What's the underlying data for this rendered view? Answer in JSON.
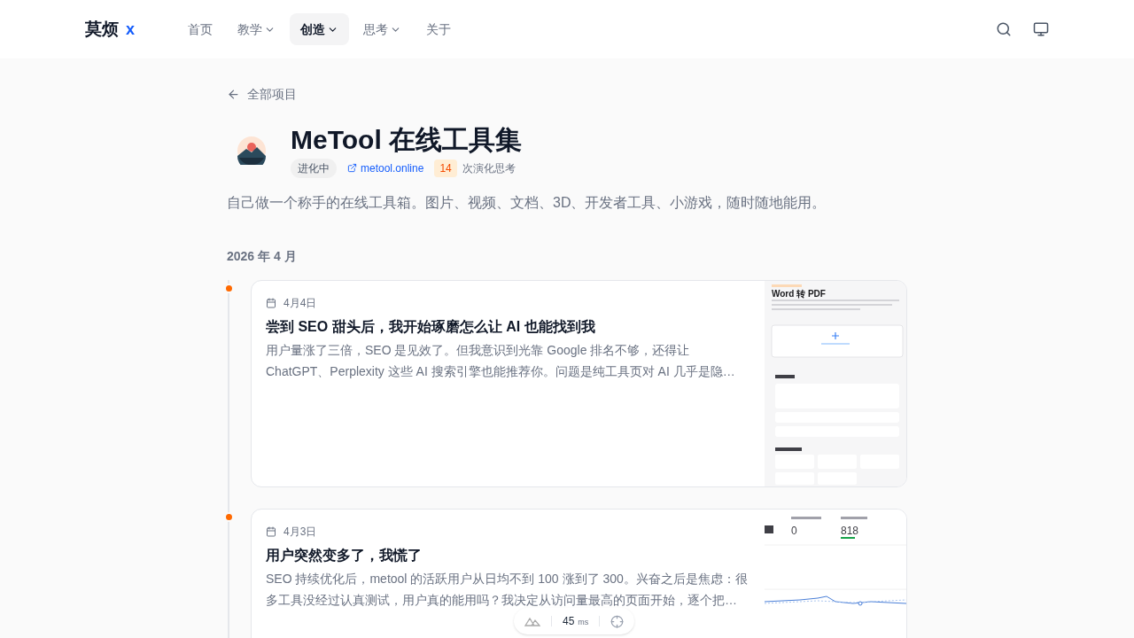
{
  "nav": {
    "logo": "莫烦",
    "logo_mark": "x",
    "items": [
      {
        "label": "首页",
        "dropdown": false,
        "selected": false
      },
      {
        "label": "教学",
        "dropdown": true,
        "selected": false
      },
      {
        "label": "创造",
        "dropdown": true,
        "selected": true
      },
      {
        "label": "思考",
        "dropdown": true,
        "selected": false
      },
      {
        "label": "关于",
        "dropdown": false,
        "selected": false
      }
    ]
  },
  "back_link": "全部项目",
  "project": {
    "title": "MeTool 在线工具集",
    "status": "进化中",
    "link": "metool.online",
    "count": "14",
    "count_label": "次演化思考",
    "description": "自己做一个称手的在线工具箱。图片、视频、文档、3D、开发者工具、小游戏，随时随地能用。"
  },
  "month": "2026 年 4 月",
  "posts": [
    {
      "date": "4月4日",
      "title": "尝到 SEO 甜头后，我开始琢磨怎么让 AI 也能找到我",
      "excerpt": "用户量涨了三倍，SEO 是见效了。但我意识到光靠 Google 排名不够，还得让 ChatGPT、Perplexity 这些 AI 搜索引擎也能推荐你。问题是纯工具页对 AI 几乎是隐…",
      "thumbnail": {
        "kind": "tool_page",
        "title": "Word 转 PDF"
      }
    },
    {
      "date": "4月3日",
      "title": "用户突然变多了，我慌了",
      "excerpt": "SEO 持续优化后，metool 的活跃用户从日均不到 100 涨到了 300。兴奋之后是焦虑：很多工具没经过认真测试，用户真的能用吗？我决定从访问量最高的页面开始，逐个把…",
      "thumbnail": {
        "kind": "analytics",
        "values": [
          "0",
          "818"
        ]
      }
    }
  ],
  "perf": {
    "value": "45",
    "unit": "ms"
  }
}
